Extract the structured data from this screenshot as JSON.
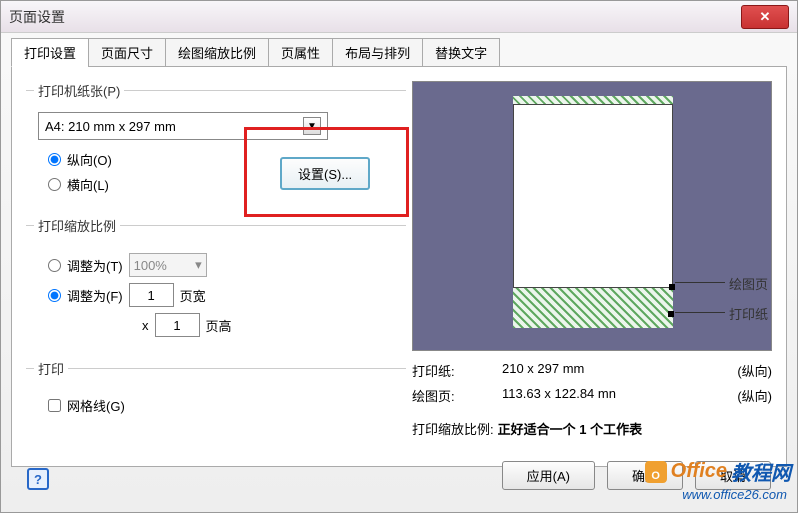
{
  "title": "页面设置",
  "tabs": [
    "打印设置",
    "页面尺寸",
    "绘图缩放比例",
    "页属性",
    "布局与排列",
    "替换文字"
  ],
  "active_tab": 0,
  "printer_paper": {
    "legend": "打印机纸张(P)",
    "paper_size": "A4:  210 mm x 297 mm",
    "orient_portrait": "纵向(O)",
    "orient_landscape": "横向(L)",
    "setup_button": "设置(S)..."
  },
  "print_scale": {
    "legend": "打印缩放比例",
    "adjust_to": "调整为(T)",
    "percent": "100%",
    "fit_to": "调整为(F)",
    "pages_wide_value": "1",
    "pages_wide_label": "页宽",
    "by_label": "x",
    "pages_tall_value": "1",
    "pages_tall_label": "页高"
  },
  "print": {
    "legend": "打印",
    "gridlines": "网格线(G)"
  },
  "preview_labels": {
    "drawing_page": "绘图页",
    "print_paper": "打印纸"
  },
  "info": {
    "paper_label": "打印纸:",
    "paper_value": "210 x 297 mm",
    "paper_orient": "(纵向)",
    "drawing_label": "绘图页:",
    "drawing_value": "113.63 x 122.84 mn",
    "drawing_orient": "(纵向)",
    "scale_label": "打印缩放比例:",
    "scale_value": "正好适合一个 1 个工作表"
  },
  "buttons": {
    "apply": "应用(A)",
    "ok": "确定",
    "cancel": "取消"
  },
  "watermark": {
    "office": "Office",
    "tutorial": "教程网",
    "url": "www.office26.com"
  }
}
